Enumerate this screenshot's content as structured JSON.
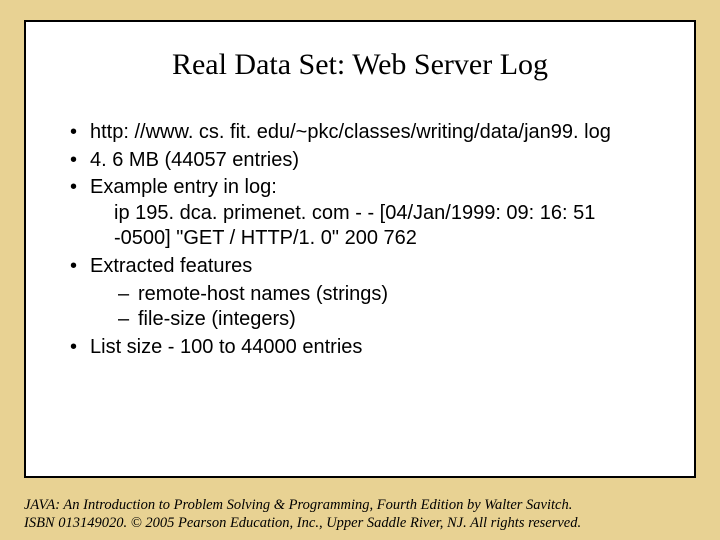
{
  "title": "Real Data Set: Web Server Log",
  "bullets": {
    "b1": "http: //www. cs. fit. edu/~pkc/classes/writing/data/jan99. log",
    "b2": "4. 6 MB (44057 entries)",
    "b3": "Example entry in log:",
    "b3_detail": "ip 195. dca. primenet. com - - [04/Jan/1999: 09: 16: 51 -0500] \"GET / HTTP/1. 0\" 200 762",
    "b4": "Extracted features",
    "b4_sub1": "remote-host names (strings)",
    "b4_sub2": "file-size (integers)",
    "b5": "List size - 100 to 44000 entries"
  },
  "footer_line1": "JAVA: An Introduction to Problem Solving & Programming, Fourth Edition by Walter Savitch.",
  "footer_line2": "ISBN 013149020. © 2005 Pearson Education, Inc., Upper Saddle River, NJ. All rights reserved."
}
